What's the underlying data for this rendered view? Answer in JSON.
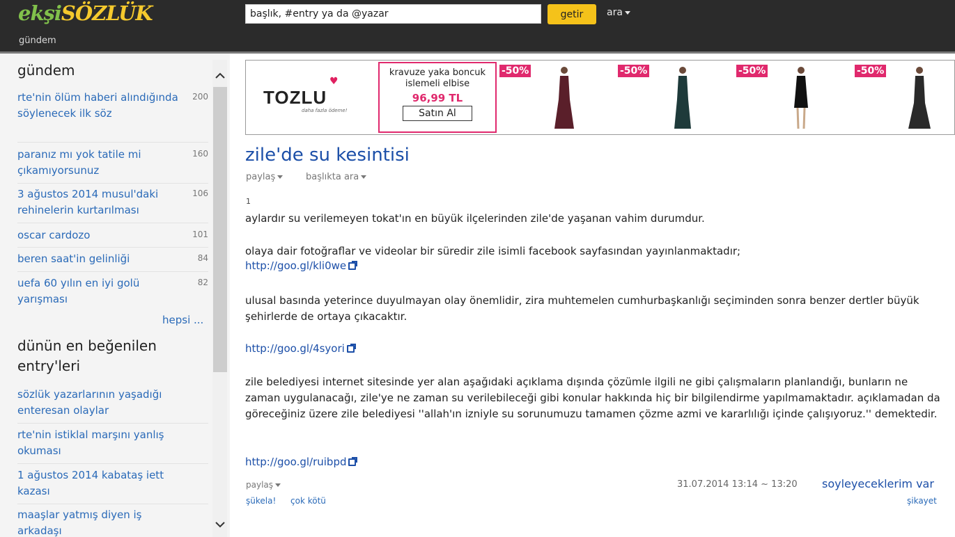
{
  "header": {
    "logo_part1": "ekşi",
    "logo_part2": "SÖZLÜK",
    "search_placeholder": "başlık, #entry ya da @yazar",
    "search_button": "getir",
    "search_menu": "ara",
    "nav_item": "gündem"
  },
  "sidebar": {
    "gundem_title": "gündem",
    "gundem_items": [
      {
        "title": "rte'nin ölüm haberi alındığında söylenecek ilk söz",
        "count": "200"
      },
      {
        "title": "paranız mı yok tatile mi çıkamıyorsunuz",
        "count": "160"
      },
      {
        "title": "3 ağustos 2014 musul'daki rehinelerin kurtarılması",
        "count": "106"
      },
      {
        "title": "oscar cardozo",
        "count": "101"
      },
      {
        "title": "beren saat'in gelinliği",
        "count": "84"
      },
      {
        "title": "uefa 60 yılın en iyi golü yarışması",
        "count": "82"
      }
    ],
    "more_link": "hepsi ...",
    "top_title": "dünün en beğenilen entry'leri",
    "top_items": [
      "sözlük yazarlarının yaşadığı enteresan olaylar",
      "rte'nin istiklal marşını yanlış okuması",
      "1 ağustos 2014 kabataş iett kazası",
      "maaşlar yatmış diyen iş arkadaşı"
    ]
  },
  "ad": {
    "brand": "TOZLU",
    "slogan": "daha fazla ödeme!",
    "product": "kravuze yaka boncuk islemeli elbise",
    "price": "96,99 TL",
    "buy_button": "Satın Al",
    "discounts": [
      "-50%",
      "-50%",
      "-50%",
      "-50%"
    ],
    "colors": {
      "accent": "#e0296d"
    }
  },
  "topic": {
    "title": "zile'de su kesintisi",
    "share_menu": "paylaş",
    "search_in_topic": "başlıkta ara"
  },
  "entry": {
    "number": "1",
    "p1": "aylardır su verilemeyen tokat'ın en büyük ilçelerinden zile'de yaşanan vahim durumdur.",
    "p2": "olaya dair fotoğraflar ve videolar bir süredir zile isimli facebook sayfasından yayınlanmaktadır;",
    "link1": "http://goo.gl/kli0we",
    "p3": "ulusal basında yeterince duyulmayan olay önemlidir, zira muhtemelen cumhurbaşkanlığı seçiminden sonra benzer dertler büyük şehirlerde de ortaya çıkacaktır.",
    "link2": "http://goo.gl/4syori",
    "p4": "zile belediyesi internet sitesinde yer alan aşağıdaki açıklama dışında çözümle ilgili ne gibi çalışmaların planlandığı, bunların ne zaman uygulanacağı, zile'ye ne zaman su verilebileceği gibi konular hakkında hiç bir bilgilendirme yapılmamaktadır. açıklamadan da göreceğiniz üzere zile belediyesi ''allah'ın izniyle su sorunumuzu tamamen çözme azmi ve kararlılığı içinde çalışıyoruz.'' demektedir.",
    "link3": "http://goo.gl/ruibpd",
    "share": "paylaş",
    "upvote": "şükela!",
    "downvote": "çok kötü",
    "date": "31.07.2014 13:14 ~ 13:20",
    "author": "soyleyeceklerim var",
    "report": "şikayet"
  }
}
